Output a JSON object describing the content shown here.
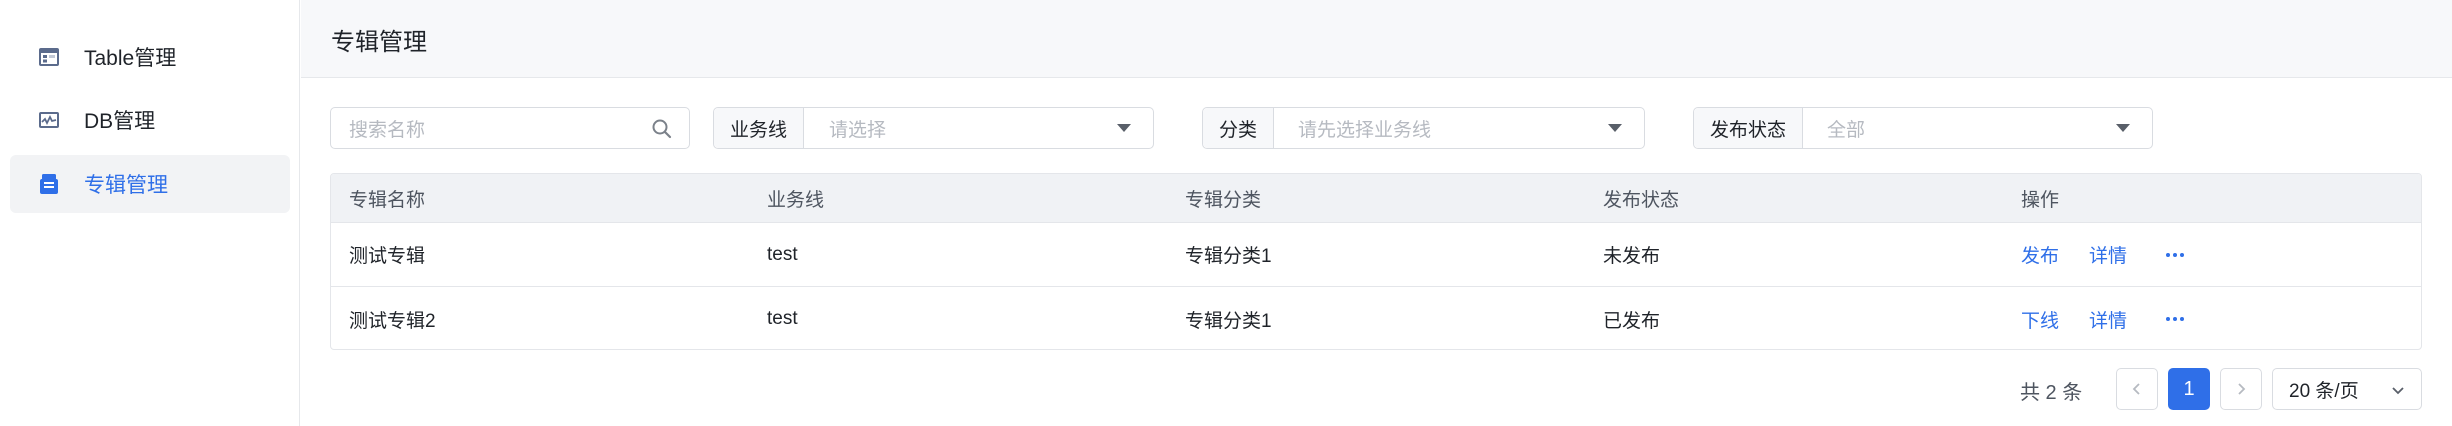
{
  "sidebar": {
    "items": [
      {
        "label": "Table管理",
        "icon": "table-icon"
      },
      {
        "label": "DB管理",
        "icon": "db-monitor-icon"
      },
      {
        "label": "专辑管理",
        "icon": "album-icon",
        "active": true
      }
    ]
  },
  "header": {
    "title": "专辑管理"
  },
  "filters": {
    "search_placeholder": "搜索名称",
    "business_label": "业务线",
    "business_placeholder": "请选择",
    "category_label": "分类",
    "category_placeholder": "请先选择业务线",
    "status_label": "发布状态",
    "status_value": "全部"
  },
  "table": {
    "columns": [
      "专辑名称",
      "业务线",
      "专辑分类",
      "发布状态",
      "操作"
    ],
    "rows": [
      {
        "name": "测试专辑",
        "business": "test",
        "category": "专辑分类1",
        "status": "未发布",
        "action": "发布",
        "detail": "详情"
      },
      {
        "name": "测试专辑2",
        "business": "test",
        "category": "专辑分类1",
        "status": "已发布",
        "action": "下线",
        "detail": "详情"
      }
    ]
  },
  "pagination": {
    "total_text": "共 2 条",
    "current_page": "1",
    "page_size": "20 条/页"
  },
  "colors": {
    "accent": "#2f6fe8",
    "header_bg": "#f7f8fa"
  }
}
